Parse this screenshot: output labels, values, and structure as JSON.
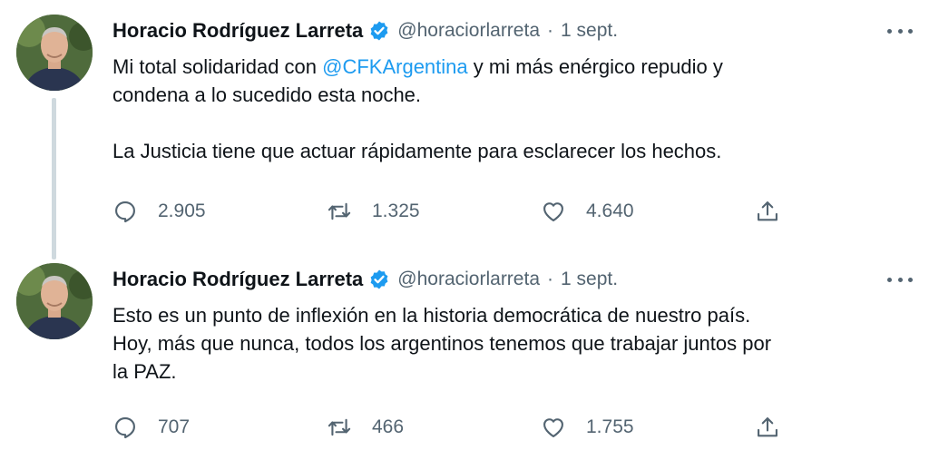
{
  "tweets": [
    {
      "author": "Horacio Rodríguez Larreta",
      "handle": "@horaciorlarreta",
      "separator": "·",
      "date": "1 sept.",
      "text": {
        "line1_before": "Mi total solidaridad con ",
        "mention": "@CFKArgentina",
        "line1_after": " y mi más enérgico repudio y",
        "line2": "condena a lo sucedido esta noche.",
        "paragraph2": "La Justicia tiene que actuar rápidamente para esclarecer los hechos."
      },
      "stats": {
        "replies": "2.905",
        "retweets": "1.325",
        "likes": "4.640"
      }
    },
    {
      "author": "Horacio Rodríguez Larreta",
      "handle": "@horaciorlarreta",
      "separator": "·",
      "date": "1 sept.",
      "text": {
        "line1": "Esto es un punto de inflexión en la historia democrática de nuestro país.",
        "line2": "Hoy, más que nunca, todos los argentinos tenemos que trabajar juntos por",
        "line3": "la PAZ."
      },
      "stats": {
        "replies": "707",
        "retweets": "466",
        "likes": "1.755"
      }
    }
  ],
  "icons": {
    "verified": "verified-badge-icon",
    "more": "more-options-icon",
    "reply": "reply-icon",
    "retweet": "retweet-icon",
    "like": "like-icon",
    "share": "share-icon"
  },
  "colors": {
    "text": "#0f1419",
    "secondary": "#536471",
    "link": "#1d9bf0",
    "thread_line": "#cfd9de",
    "verified": "#1d9bf0"
  }
}
